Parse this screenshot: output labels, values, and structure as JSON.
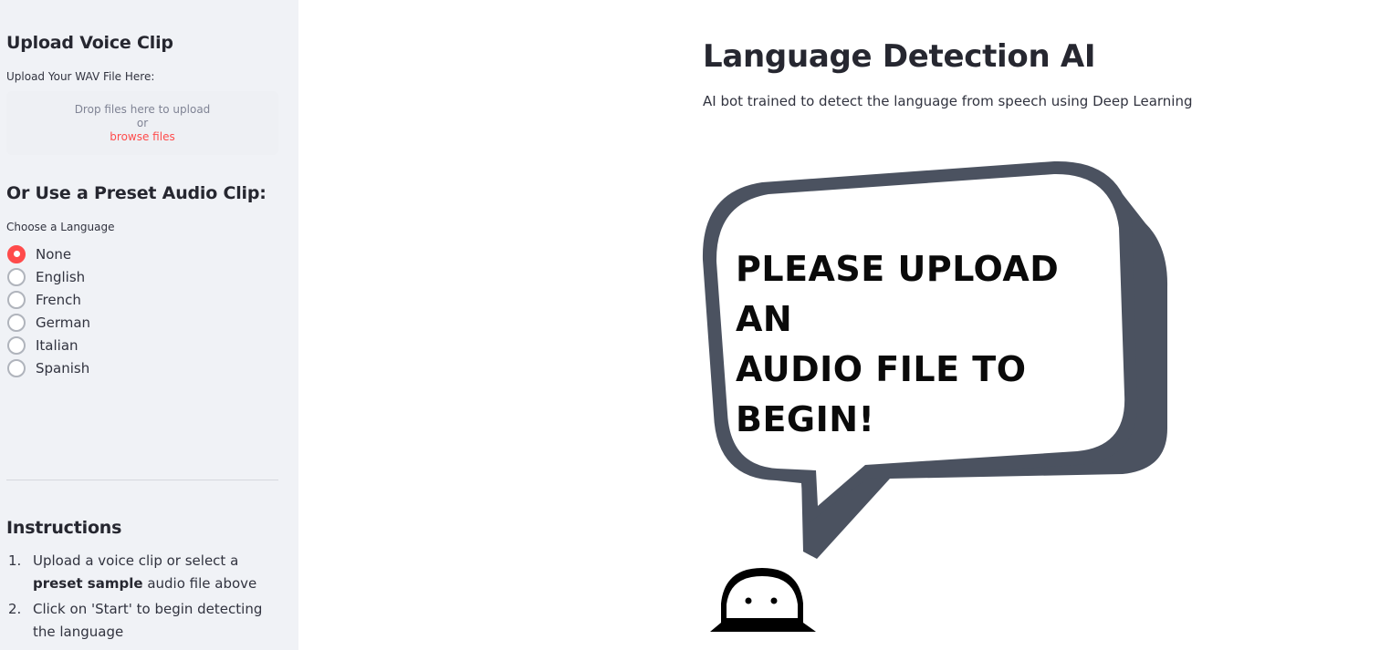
{
  "sidebar": {
    "upload_heading": "Upload Voice Clip",
    "upload_label": "Upload Your WAV File Here:",
    "dropzone": {
      "line1": "Drop files here to upload",
      "line2": "or",
      "browse_link": "browse files"
    },
    "preset_heading": "Or Use a Preset Audio Clip:",
    "language_label": "Choose a Language",
    "languages": [
      {
        "label": "None",
        "selected": true
      },
      {
        "label": "English",
        "selected": false
      },
      {
        "label": "French",
        "selected": false
      },
      {
        "label": "German",
        "selected": false
      },
      {
        "label": "Italian",
        "selected": false
      },
      {
        "label": "Spanish",
        "selected": false
      }
    ],
    "instructions_heading": "Instructions",
    "instructions": [
      {
        "num": "1.",
        "pre": "Upload a voice clip or select a ",
        "bold": "preset sample",
        "post": " audio file above"
      },
      {
        "num": "2.",
        "pre": "Click on 'Start' to begin detecting the language",
        "bold": "",
        "post": ""
      }
    ]
  },
  "main": {
    "title": "Language Detection AI",
    "subtitle": "AI bot trained to detect the language from speech using Deep Learning",
    "bubble_lines": [
      "PLEASE UPLOAD AN",
      "AUDIO FILE TO",
      "BEGIN!"
    ]
  },
  "colors": {
    "accent": "#ff4b4b",
    "sidebar_bg": "#f0f2f6",
    "bubble_shadow": "#4b5260"
  }
}
